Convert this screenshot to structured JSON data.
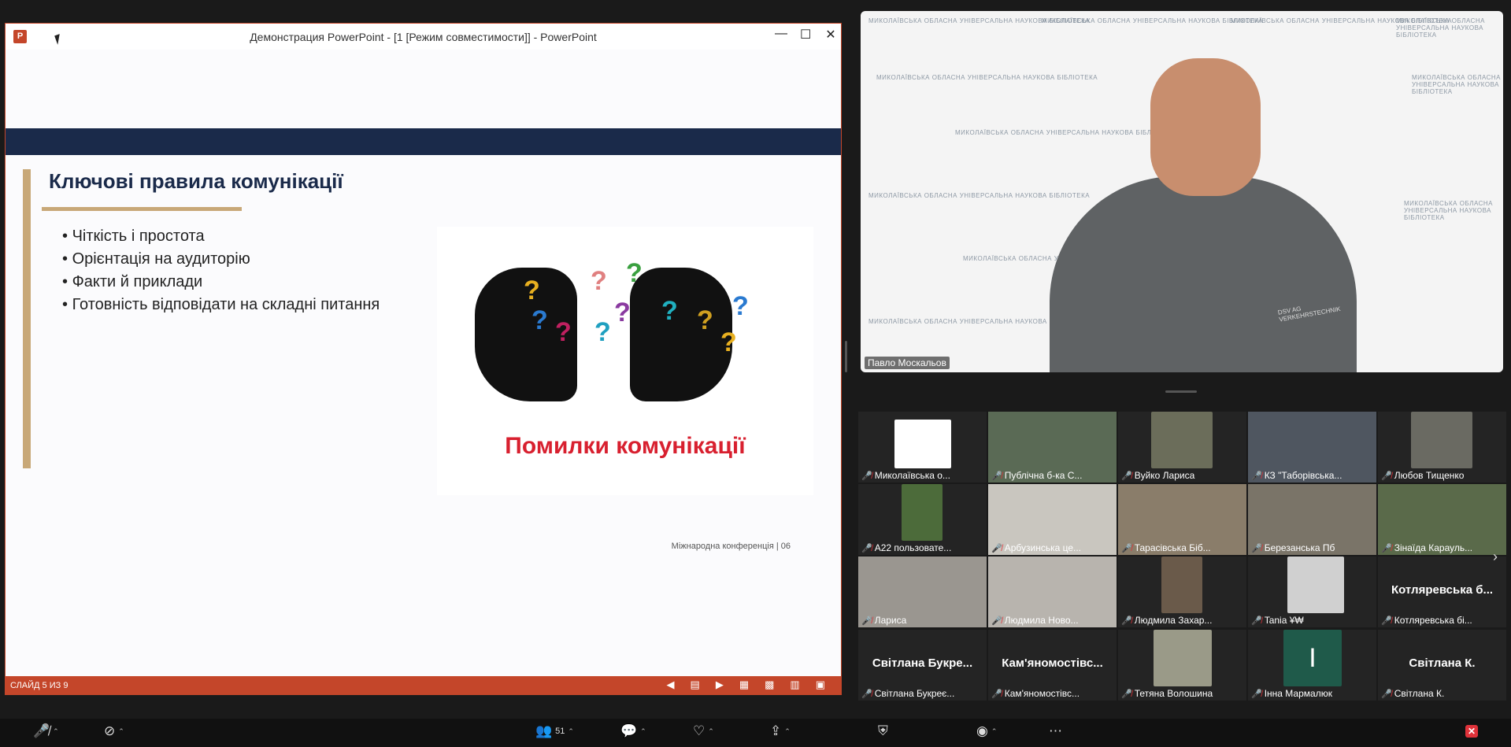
{
  "ppt": {
    "window_title": "Демонстрация PowerPoint - [1 [Режим совместимости]] - PowerPoint",
    "logo_letter": "P",
    "controls": {
      "minimize": "—",
      "maximize": "☐",
      "close": "✕"
    },
    "slide": {
      "title": "Ключові правила комунікації",
      "bullets": [
        "Чіткість і простота",
        "Орієнтація на аудиторію",
        "Факти й приклади",
        "Готовність відповідати на складні питання"
      ],
      "image_caption": "Помилки комунікації",
      "footer_note": "Міжнародна конференція | 06"
    },
    "status": {
      "slide_counter": "СЛАЙД 5 ИЗ 9",
      "icons": [
        "prev-icon",
        "notes-icon",
        "next-icon",
        "normal-view-icon",
        "sorter-view-icon",
        "reading-view-icon",
        "slideshow-icon"
      ]
    }
  },
  "speaker": {
    "name": "Павло Москальов",
    "shirt_text": "DSV AG VERKEHRSTECHNIK",
    "backdrop_logo_text": "МИКОЛАЇВСЬКА ОБЛАСНА УНІВЕРСАЛЬНА НАУКОВА БІБЛІОТЕКА"
  },
  "gallery": {
    "tiles": [
      {
        "label": "Миколаївська о...",
        "kind": "logo",
        "bg": "#2a2a2a",
        "big": ""
      },
      {
        "label": "Публічна б-ка С...",
        "kind": "video",
        "bg": "#5a6a55",
        "big": ""
      },
      {
        "label": "Вуйко Лариса",
        "kind": "video",
        "bg": "#6b6d5a",
        "big": ""
      },
      {
        "label": "КЗ \"Таборівська...",
        "kind": "video",
        "bg": "#4f5660",
        "big": ""
      },
      {
        "label": "Любов Тищенко",
        "kind": "video",
        "bg": "#6a6a62",
        "big": ""
      },
      {
        "label": "А22 пользовате...",
        "kind": "video",
        "bg": "#4c6b3a",
        "big": ""
      },
      {
        "label": "Арбузинська це...",
        "kind": "video",
        "bg": "#c9c6bf",
        "big": ""
      },
      {
        "label": "Тарасівська Біб...",
        "kind": "video",
        "bg": "#8a7d6a",
        "big": ""
      },
      {
        "label": "Березанська Пб",
        "kind": "video",
        "bg": "#7a7468",
        "big": ""
      },
      {
        "label": "Зінаїда Карауль...",
        "kind": "video",
        "bg": "#5a6a4a",
        "big": ""
      },
      {
        "label": "Лариса",
        "kind": "video",
        "bg": "#9a9690",
        "big": ""
      },
      {
        "label": "Людмила Ново...",
        "kind": "video",
        "bg": "#b8b4ae",
        "big": ""
      },
      {
        "label": "Людмила Захар...",
        "kind": "video",
        "bg": "#6a5a4a",
        "big": ""
      },
      {
        "label": "Tania ¥₩",
        "kind": "video",
        "bg": "#d0d0d0",
        "big": ""
      },
      {
        "label": "Котлярeвська бі...",
        "kind": "name",
        "bg": "#242424",
        "big": "Котлярeвська б..."
      },
      {
        "label": "Світлана Букреє...",
        "kind": "name",
        "bg": "#242424",
        "big": "Світлана Букре..."
      },
      {
        "label": "Кам'яномостівс...",
        "kind": "name",
        "bg": "#242424",
        "big": "Кам'яномостівс..."
      },
      {
        "label": "Тетяна Волошина",
        "kind": "video",
        "bg": "#9a9a88",
        "big": ""
      },
      {
        "label": "Інна Мармалюк",
        "kind": "avatar",
        "bg": "#242424",
        "big": "І"
      },
      {
        "label": "Світлана К.",
        "kind": "name",
        "bg": "#242424",
        "big": "Світлана К."
      }
    ]
  },
  "toolbar": {
    "participants_count": "51",
    "mic_icon": "mic-off-icon",
    "video_icon": "video-off-icon",
    "colors": {
      "accent": "#c4462a",
      "end": "#e0323a",
      "navy": "#1a2a4a",
      "gold": "#c8a878"
    }
  }
}
